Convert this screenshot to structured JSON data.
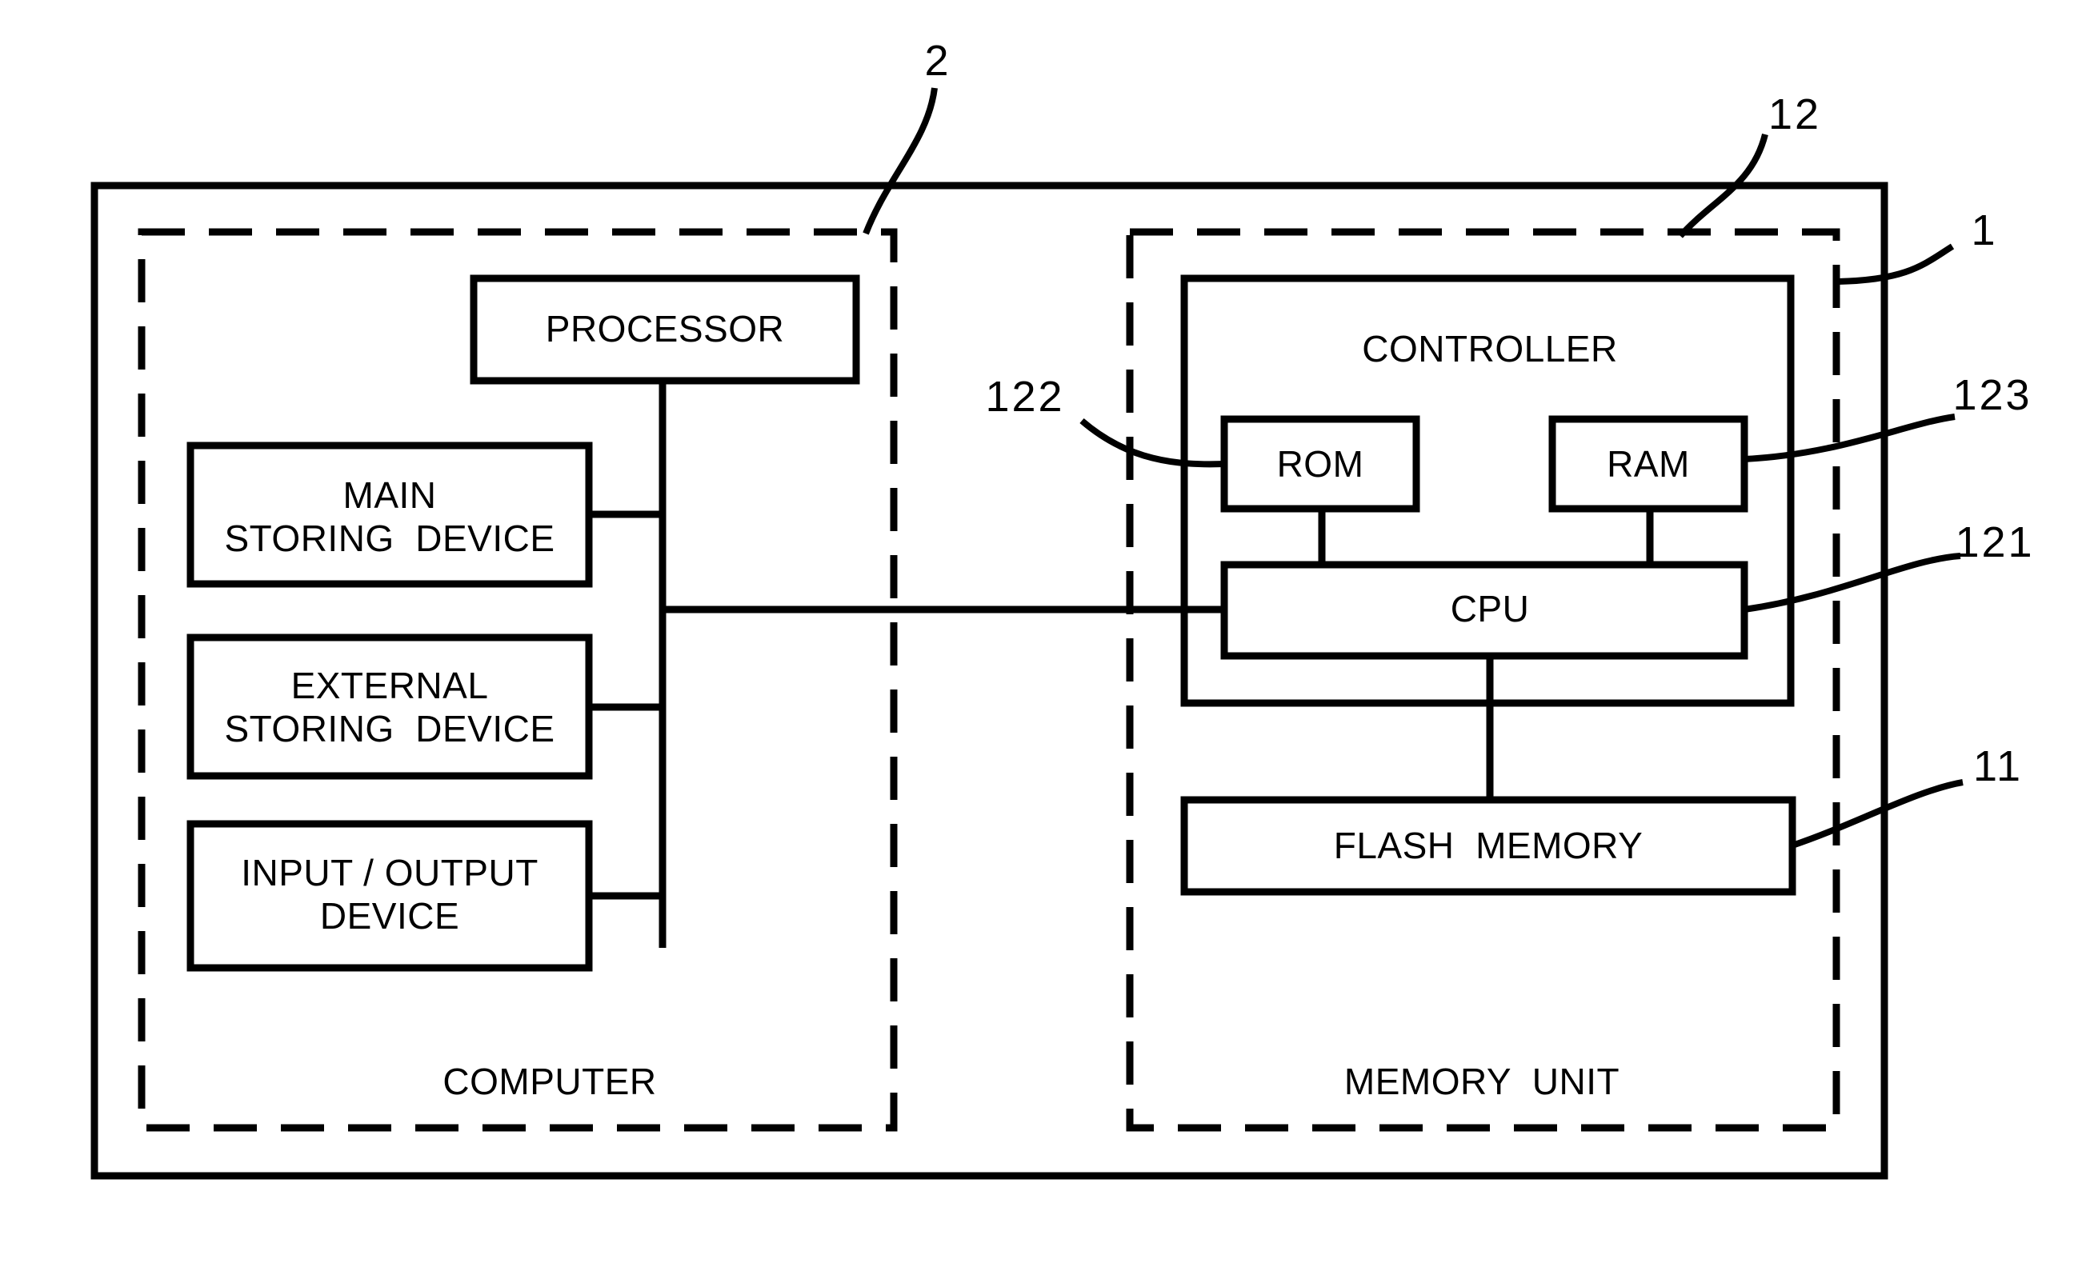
{
  "figure": {
    "type": "patent-block-diagram",
    "title": "",
    "background_color": "#ffffff",
    "line_color": "#000000"
  },
  "outer_enclosure": {
    "name": "system-enclosure",
    "style": "solid"
  },
  "groups": [
    {
      "id": "computer",
      "caption": "COMPUTER",
      "reference_numeral": "2",
      "style": "dashed"
    },
    {
      "id": "memory_unit",
      "caption": "MEMORY UNIT",
      "reference_numeral": "1",
      "style": "dashed"
    }
  ],
  "blocks": [
    {
      "id": "processor",
      "label": "PROCESSOR",
      "lines": [
        "PROCESSOR"
      ],
      "reference_numeral": ""
    },
    {
      "id": "main_storing",
      "label": "MAIN STORING DEVICE",
      "lines": [
        "MAIN",
        "STORING  DEVICE"
      ],
      "reference_numeral": ""
    },
    {
      "id": "external_storing",
      "label": "EXTERNAL STORING DEVICE",
      "lines": [
        "EXTERNAL",
        "STORING  DEVICE"
      ],
      "reference_numeral": ""
    },
    {
      "id": "input_output",
      "label": "INPUT / OUTPUT DEVICE",
      "lines": [
        "INPUT / OUTPUT",
        "DEVICE"
      ],
      "reference_numeral": ""
    },
    {
      "id": "controller",
      "label": "CONTROLLER",
      "lines": [
        "CONTROLLER"
      ],
      "reference_numeral": "12"
    },
    {
      "id": "rom",
      "label": "ROM",
      "lines": [
        "ROM"
      ],
      "reference_numeral": "122"
    },
    {
      "id": "ram",
      "label": "RAM",
      "lines": [
        "RAM"
      ],
      "reference_numeral": "123"
    },
    {
      "id": "cpu",
      "label": "CPU",
      "lines": [
        "CPU"
      ],
      "reference_numeral": "121"
    },
    {
      "id": "flash_memory",
      "label": "FLASH MEMORY",
      "lines": [
        "FLASH  MEMORY"
      ],
      "reference_numeral": "11"
    }
  ],
  "labels": {
    "processor": "PROCESSOR",
    "main_storing_l1": "MAIN",
    "main_storing_l2": "STORING  DEVICE",
    "external_storing_l1": "EXTERNAL",
    "external_storing_l2": "STORING  DEVICE",
    "input_output_l1": "INPUT / OUTPUT",
    "input_output_l2": "DEVICE",
    "controller": "CONTROLLER",
    "rom": "ROM",
    "ram": "RAM",
    "cpu": "CPU",
    "flash_memory": "FLASH  MEMORY",
    "computer": "COMPUTER",
    "memory_unit": "MEMORY  UNIT"
  },
  "reference_numerals": {
    "system": "1",
    "computer": "2",
    "flash_memory": "11",
    "controller": "12",
    "cpu": "121",
    "rom": "122",
    "ram": "123"
  },
  "connections": [
    {
      "from": "processor",
      "to": "bus",
      "kind": "solid-line"
    },
    {
      "from": "main_storing",
      "to": "bus",
      "kind": "solid-line"
    },
    {
      "from": "external_storing",
      "to": "bus",
      "kind": "solid-line"
    },
    {
      "from": "input_output",
      "to": "bus",
      "kind": "solid-line"
    },
    {
      "from": "bus",
      "to": "cpu",
      "kind": "solid-line"
    },
    {
      "from": "rom",
      "to": "cpu",
      "kind": "solid-line"
    },
    {
      "from": "ram",
      "to": "cpu",
      "kind": "solid-line"
    },
    {
      "from": "cpu",
      "to": "flash_memory",
      "kind": "solid-line"
    }
  ]
}
